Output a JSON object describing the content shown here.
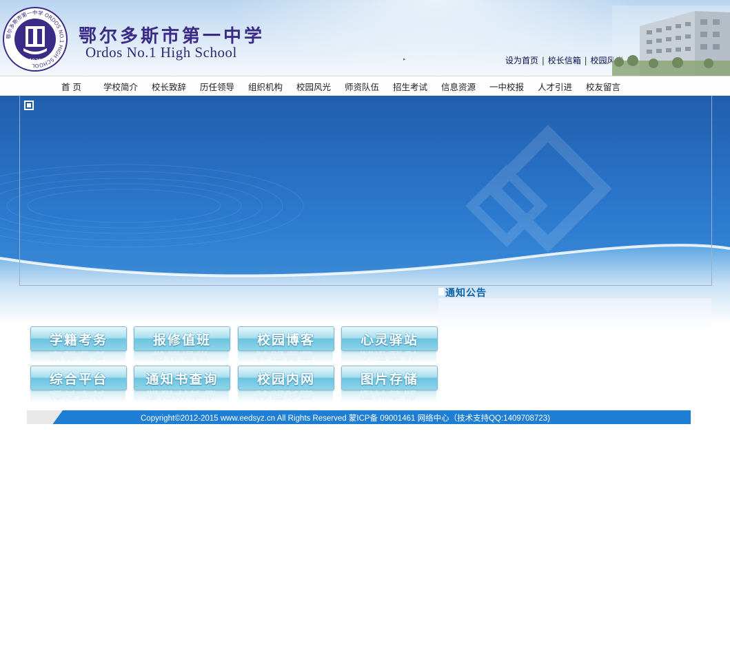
{
  "header": {
    "title_cn": "鄂尔多斯市第一中学",
    "title_en": "Ordos No.1 High School",
    "logo_ring_text": "鄂尔多斯市第一中学 ORDOS NO.1 HIGH SCHOOL",
    "logo_year": "1939",
    "quicklinks": [
      "设为首页",
      "校长信箱",
      "校园风光"
    ],
    "quicklink_sep": "|"
  },
  "nav": {
    "items": [
      "首 页",
      "学校简介",
      "校长致辞",
      "历任领导",
      "组织机构",
      "校园风光",
      "师资队伍",
      "招生考试",
      "信息资源",
      "一中校报",
      "人才引进",
      "校友留言"
    ]
  },
  "notice": {
    "title": "通知公告"
  },
  "quick_buttons": [
    [
      "学籍考务",
      "报修值班",
      "校园博客",
      "心灵驿站"
    ],
    [
      "综合平台",
      "通知书查询",
      "校园内网",
      "图片存储"
    ]
  ],
  "footer": {
    "text": "Copyright©2012-2015 www.eedsyz.cn All Rights Reserved 蒙ICP备 09001461 网络中心（技术支持QQ:1409708723)"
  },
  "colors": {
    "banner": "#2c7bd0",
    "footer": "#1d7ed3",
    "title": "#3b2a86",
    "notice_title": "#0d63a8"
  }
}
